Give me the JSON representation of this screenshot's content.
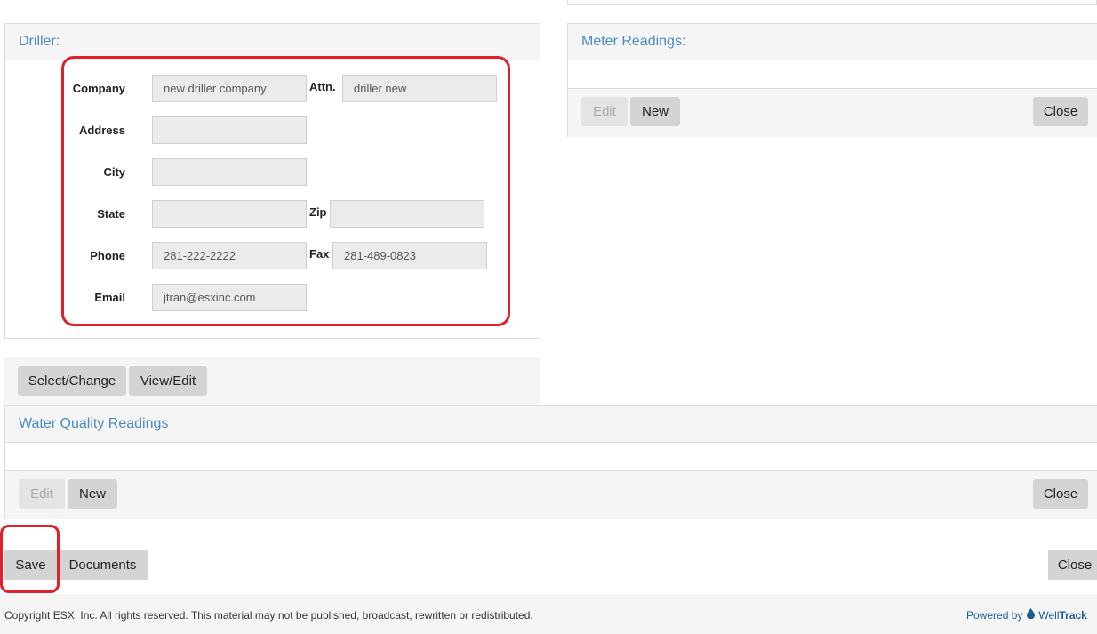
{
  "driller": {
    "title": "Driller:",
    "labels": {
      "company": "Company",
      "attn": "Attn.",
      "address": "Address",
      "city": "City",
      "state": "State",
      "zip": "Zip",
      "phone": "Phone",
      "fax": "Fax",
      "email": "Email"
    },
    "values": {
      "company": "new driller company",
      "attn": "driller new",
      "address": "",
      "city": "",
      "state": "",
      "zip": "",
      "phone": "281-222-2222",
      "fax": "281-489-0823",
      "email": "jtran@esxinc.com"
    },
    "buttons": {
      "select_change": "Select/Change",
      "view_edit": "View/Edit"
    }
  },
  "meter_readings": {
    "title": "Meter Readings:",
    "buttons": {
      "edit": "Edit",
      "new": "New",
      "close": "Close"
    }
  },
  "water_quality": {
    "title": "Water Quality Readings",
    "buttons": {
      "edit": "Edit",
      "new": "New",
      "close": "Close"
    }
  },
  "actions": {
    "save": "Save",
    "documents": "Documents",
    "close": "Close"
  },
  "footer": {
    "copyright": "Copyright ESX, Inc. All rights reserved. This material may not be published, broadcast, rewritten or redistributed.",
    "powered_by": "Powered by",
    "brand_prefix": "Well",
    "brand_suffix": "Track"
  },
  "colors": {
    "accent": "#4a8ac4",
    "highlight": "#e0202a",
    "brand": "#1a5f99"
  },
  "icons": {
    "brand_logo": "water-drop-icon"
  }
}
